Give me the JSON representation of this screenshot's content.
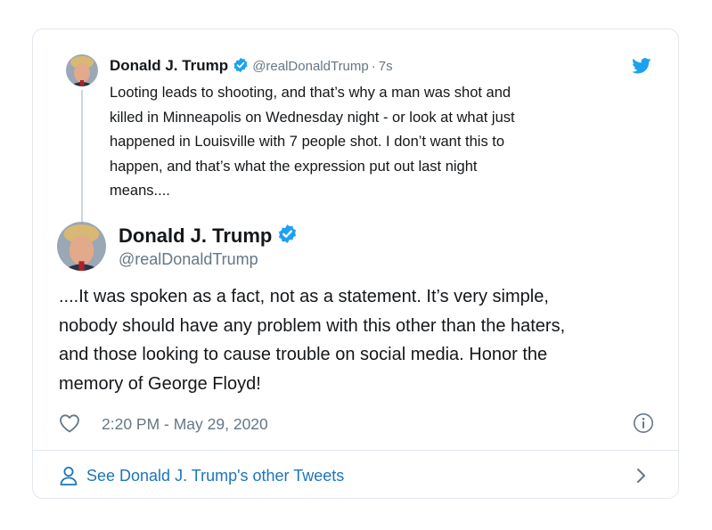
{
  "parent_tweet": {
    "author_name": "Donald J. Trump",
    "handle": "@realDonaldTrump",
    "separator": "·",
    "time_ago": "7s",
    "text_lines": [
      "Looting leads to shooting, and that’s why a man was shot and",
      "killed in Minneapolis on Wednesday night - or look at what just",
      "happened in Louisville with 7 people shot. I don’t want this to",
      "happen, and that’s what the expression put out last night",
      "means...."
    ]
  },
  "main_tweet": {
    "author_name": "Donald J. Trump",
    "handle": "@realDonaldTrump",
    "text_lines": [
      "....It was spoken as a fact, not as a statement. It’s very simple,",
      "nobody should have any problem with this other than the haters,",
      "and those looking to cause trouble on social media. Honor the",
      "memory of George Floyd!"
    ],
    "timestamp": "2:20 PM - May 29, 2020"
  },
  "footer": {
    "see_more_label": "See Donald J. Trump's other Tweets"
  },
  "icons": {
    "verified": "verified-badge-icon",
    "twitter": "twitter-bird-icon",
    "like": "heart-icon",
    "info": "info-icon",
    "person": "person-icon",
    "chevron": "chevron-right-icon"
  },
  "colors": {
    "accent_blue": "#1da1f2",
    "link_blue": "#1b75bb",
    "secondary_text": "#657786",
    "border": "#e1e8ed"
  }
}
